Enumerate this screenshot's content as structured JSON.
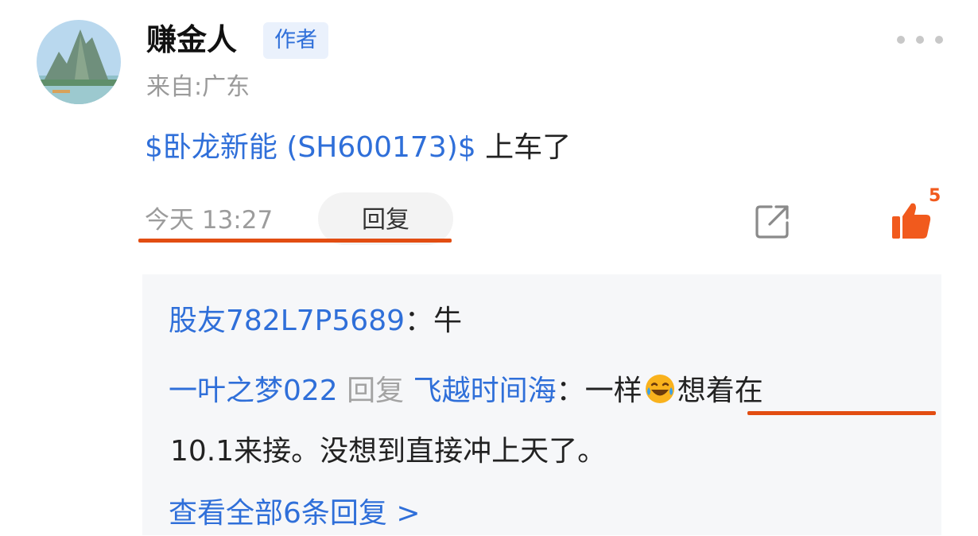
{
  "user": {
    "name": "赚金人",
    "badge": "作者",
    "location": "来自:广东"
  },
  "post": {
    "stock": "$卧龙新能 (SH600173)$",
    "text": " 上车了",
    "time": "今天 13:27",
    "reply_label": "回复",
    "like_count": "5"
  },
  "replies": [
    {
      "author": "股友782L7P5689",
      "separator": "：",
      "text": "牛"
    },
    {
      "author": "一叶之梦022",
      "reply_word": "回复",
      "target": "飞越时间海",
      "separator": "：",
      "text_before": "一样",
      "text_after": "想着在",
      "text_line2": "10.1来接。没想到直接冲上天了。"
    }
  ],
  "view_all": "查看全部6条回复 >",
  "icons": {
    "avatar": "mountain-landscape-avatar",
    "more": "more-dots-icon",
    "share": "share-icon",
    "like": "thumbs-up-icon",
    "emoji": "laughing-crying-emoji"
  },
  "colors": {
    "link": "#2f6fd9",
    "accent": "#f15a1d",
    "underline": "#e24d12",
    "reply_bg": "#f6f7f9"
  }
}
